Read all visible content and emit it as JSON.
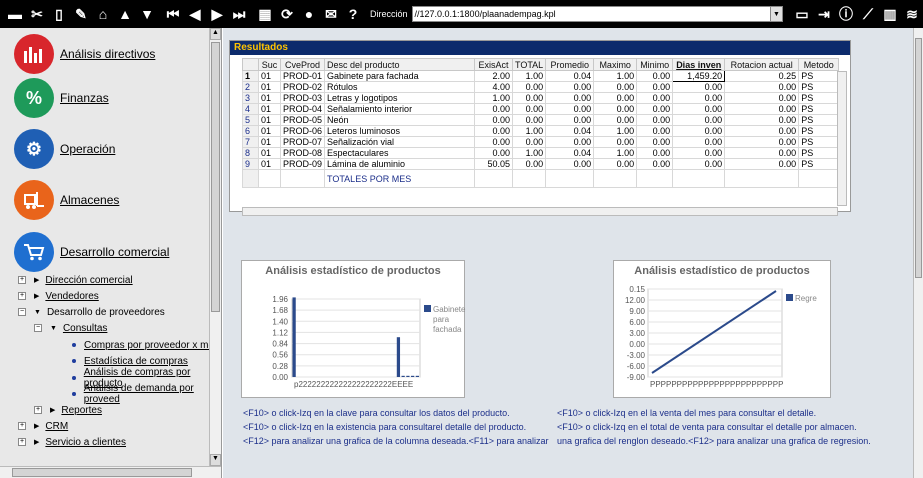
{
  "toolbar": {
    "address_label": "Dirección",
    "address_value": "//127.0.0.1:1800/plaanadempag.kpl",
    "help_glyph": "?"
  },
  "modules": [
    {
      "label": "Análisis directivos",
      "color": "#d8262c",
      "icon": "bar-chart-icon"
    },
    {
      "label": "Finanzas",
      "color": "#1e9a5a",
      "icon": "percent-icon"
    },
    {
      "label": "Operación",
      "color": "#1f5fb4",
      "icon": "gears-icon"
    },
    {
      "label": "Almacenes",
      "color": "#e9641b",
      "icon": "forklift-icon"
    },
    {
      "label": "Desarrollo comercial",
      "color": "#1f6fd0",
      "icon": "cart-icon"
    }
  ],
  "tree": {
    "direccion": "Dirección comercial",
    "vendedores": "Vendedores",
    "desarrollo": "Desarrollo de proveedores",
    "consultas": "Consultas",
    "items": [
      "Compras por proveedor x mes",
      "Estadística de compras",
      "Análisis de compras por producto",
      "Análisis de demanda por proveed"
    ],
    "reportes": "Reportes",
    "crm": "CRM",
    "servicio": "Servicio a clientes"
  },
  "results": {
    "title": "Resultados",
    "columns": [
      "Suc",
      "CveProd",
      "Desc del producto",
      "ExisAct",
      "TOTAL",
      "Promedio",
      "Maximo",
      "Minimo",
      "Dias inven",
      "Rotacion actual",
      "Metodo"
    ],
    "rows": [
      {
        "n": "1",
        "suc": "01",
        "cve": "PROD-01",
        "desc": "Gabinete para fachada",
        "exis": "2.00",
        "total": "1.00",
        "prom": "0.04",
        "max": "1.00",
        "min": "0.00",
        "dias": "1,459.20",
        "rot": "0.25",
        "met": "PS"
      },
      {
        "n": "2",
        "suc": "01",
        "cve": "PROD-02",
        "desc": "Rótulos",
        "exis": "4.00",
        "total": "0.00",
        "prom": "0.00",
        "max": "0.00",
        "min": "0.00",
        "dias": "0.00",
        "rot": "0.00",
        "met": "PS"
      },
      {
        "n": "3",
        "suc": "01",
        "cve": "PROD-03",
        "desc": "Letras y logotipos",
        "exis": "1.00",
        "total": "0.00",
        "prom": "0.00",
        "max": "0.00",
        "min": "0.00",
        "dias": "0.00",
        "rot": "0.00",
        "met": "PS"
      },
      {
        "n": "4",
        "suc": "01",
        "cve": "PROD-04",
        "desc": "Señalamiento interior",
        "exis": "0.00",
        "total": "0.00",
        "prom": "0.00",
        "max": "0.00",
        "min": "0.00",
        "dias": "0.00",
        "rot": "0.00",
        "met": "PS"
      },
      {
        "n": "5",
        "suc": "01",
        "cve": "PROD-05",
        "desc": "Neón",
        "exis": "0.00",
        "total": "0.00",
        "prom": "0.00",
        "max": "0.00",
        "min": "0.00",
        "dias": "0.00",
        "rot": "0.00",
        "met": "PS"
      },
      {
        "n": "6",
        "suc": "01",
        "cve": "PROD-06",
        "desc": "Leteros luminosos",
        "exis": "0.00",
        "total": "1.00",
        "prom": "0.04",
        "max": "1.00",
        "min": "0.00",
        "dias": "0.00",
        "rot": "0.00",
        "met": "PS"
      },
      {
        "n": "7",
        "suc": "01",
        "cve": "PROD-07",
        "desc": "Señalización vial",
        "exis": "0.00",
        "total": "0.00",
        "prom": "0.00",
        "max": "0.00",
        "min": "0.00",
        "dias": "0.00",
        "rot": "0.00",
        "met": "PS"
      },
      {
        "n": "8",
        "suc": "01",
        "cve": "PROD-08",
        "desc": "Espectaculares",
        "exis": "0.00",
        "total": "1.00",
        "prom": "0.04",
        "max": "1.00",
        "min": "0.00",
        "dias": "0.00",
        "rot": "0.00",
        "met": "PS"
      },
      {
        "n": "9",
        "suc": "01",
        "cve": "PROD-09",
        "desc": "Lámina de aluminio",
        "exis": "50.05",
        "total": "0.00",
        "prom": "0.00",
        "max": "0.00",
        "min": "0.00",
        "dias": "0.00",
        "rot": "0.00",
        "met": "PS"
      }
    ],
    "totals_label": "TOTALES POR MES"
  },
  "chart_data": [
    {
      "type": "bar",
      "title": "Análisis estadístico de productos",
      "legend": "Gabinete para fachada",
      "legend_placement": "right",
      "ylim": [
        0,
        1.96
      ],
      "yticks": [
        "1.96",
        "1.68",
        "1.40",
        "1.12",
        "0.84",
        "0.56",
        "0.28",
        "0.00"
      ],
      "xtick_label": "p222222222222222222222EEEE",
      "values": [
        2,
        0,
        0,
        0,
        0,
        0,
        0,
        0,
        0,
        0,
        0,
        0,
        0,
        0,
        0,
        0,
        0,
        0,
        0,
        0,
        0,
        0,
        1,
        0.03,
        0.03,
        0.03,
        0.03
      ],
      "color": "#2b4a8b"
    },
    {
      "type": "line",
      "title": "Análisis estadístico de productos",
      "legend": "Regresion",
      "legend_placement": "right",
      "ylim": [
        -9.0,
        0.15
      ],
      "yticks": [
        "0.15",
        "12.00",
        "9.00",
        "6.00",
        "3.00",
        "0.00",
        "-3.00",
        "-6.00",
        "-9.00"
      ],
      "xtick_label": "PPPPPPPPPPPPPPPPPPPPPPPPP",
      "x": [
        0,
        1
      ],
      "y": [
        -9.0,
        0.15
      ],
      "color": "#2b4a8b"
    }
  ],
  "hints_left": [
    "<F10> o click-Izq en la clave para consultar los datos del producto.",
    "<F10> o click-Izq en  la existencia para consultarel detalle del producto.",
    "<F12> para analizar  una grafica de la columna deseada.<F11> para analizar"
  ],
  "hints_right": [
    "<F10> o click-Izq en el la venta del mes  para consultar el detalle.",
    "<F10> o click-Izq en el total de venta  para consultar el detalle por almacen.",
    "una grafica del renglon deseado.<F12> para analizar  una grafica de regresion."
  ]
}
